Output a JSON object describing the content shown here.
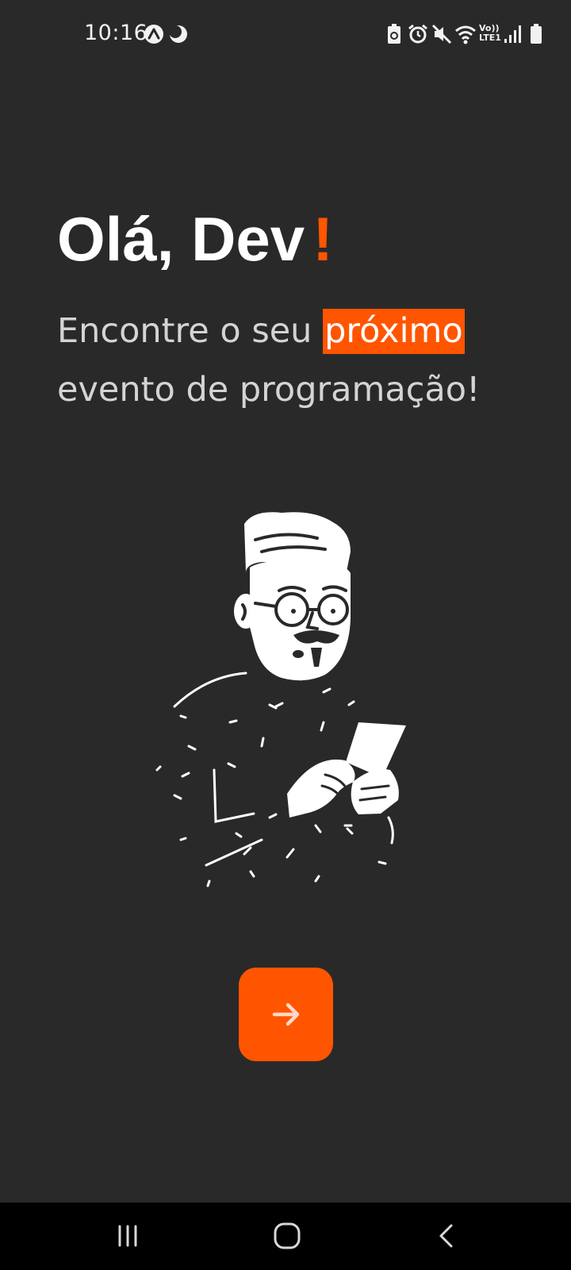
{
  "status_bar": {
    "time": "10:16",
    "left_icons": [
      "app-notification-icon",
      "night-mode-icon"
    ],
    "right_icons": [
      "battery-saver-icon",
      "alarm-icon",
      "mute-icon",
      "wifi-icon",
      "volte-lte-icon",
      "signal-icon",
      "battery-icon"
    ],
    "network_label_top": "Vo))",
    "network_label_bottom": "LTE1"
  },
  "welcome": {
    "greeting": "Olá, Dev",
    "greeting_accent": "!",
    "subtitle_before": "Encontre o seu ",
    "subtitle_highlight": "próximo",
    "subtitle_after": " evento de programação!"
  },
  "illustration": {
    "icon": "developer-with-phone-illustration"
  },
  "next_button": {
    "icon": "arrow-right-icon"
  },
  "nav_bar": {
    "items": [
      "recent-apps-icon",
      "home-icon",
      "back-icon"
    ]
  },
  "colors": {
    "background": "#292929",
    "accent": "#ff5500",
    "text_primary": "#ffffff",
    "text_secondary": "#d4d4d4",
    "nav_bar": "#000000"
  }
}
